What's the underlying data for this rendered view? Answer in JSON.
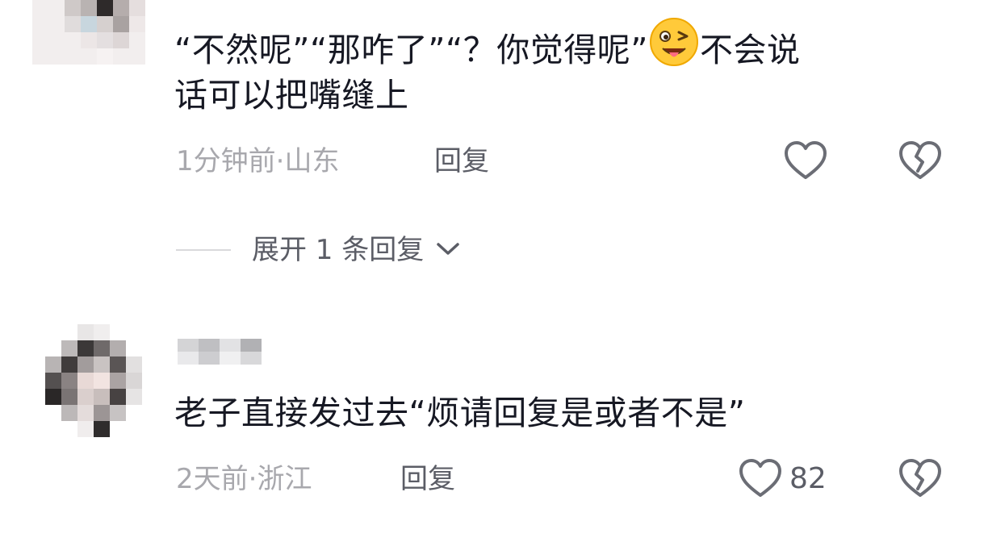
{
  "comments": [
    {
      "text_line1_part1": "“不然呢”“那咋了”“？你觉得呢”",
      "emoji_name": "wink-tongue-emoji",
      "text_line1_part2": "不会说",
      "text_line2": "话可以把嘴缝上",
      "time_location": "1分钟前·山东",
      "reply_label": "回复",
      "expand_label": "展开 1 条回复"
    },
    {
      "text": "老子直接发过去“烦请回复是或者不是”",
      "time_location": "2天前·浙江",
      "reply_label": "回复",
      "like_count": "82"
    }
  ],
  "icons": {
    "like": "heart-outline-icon",
    "dislike": "broken-heart-icon",
    "expand": "chevron-down-icon"
  },
  "colors": {
    "text": "#161823",
    "meta": "#a8a8ad",
    "action": "#5b5d66",
    "divider": "#d9d9dc"
  }
}
